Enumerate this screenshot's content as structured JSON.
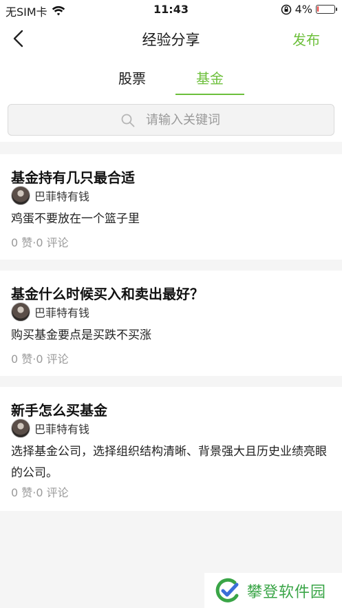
{
  "status_bar": {
    "carrier": "无SIM卡",
    "time": "11:43",
    "battery": "4%",
    "battery_level": 0.04,
    "battery_color": "#e53935"
  },
  "nav": {
    "title": "经验分享",
    "publish_label": "发布",
    "back_icon": "chevron-left-icon"
  },
  "tabs": [
    {
      "label": "股票",
      "active": false
    },
    {
      "label": "基金",
      "active": true
    }
  ],
  "search": {
    "placeholder": "请输入关键词",
    "icon": "search-icon"
  },
  "posts": [
    {
      "title": "基金持有几只最合适",
      "author": "巴菲特有钱",
      "body": "鸡蛋不要放在一个篮子里",
      "stats": "0 赞·0 评论"
    },
    {
      "title": "基金什么时候买入和卖出最好？",
      "author": "巴菲特有钱",
      "body": "购买基金要点是买跌不买涨",
      "stats": "0 赞·0 评论"
    },
    {
      "title": "新手怎么买基金",
      "author": "巴菲特有钱",
      "body": "选择基金公司，选择组织结构清晰、背景强大且历史业绩亮眼的公司。",
      "stats": "0 赞·0 评论"
    }
  ],
  "watermark": {
    "text": "攀登软件园"
  },
  "colors": {
    "accent": "#6cbf3a",
    "background": "#f5f5f5"
  }
}
